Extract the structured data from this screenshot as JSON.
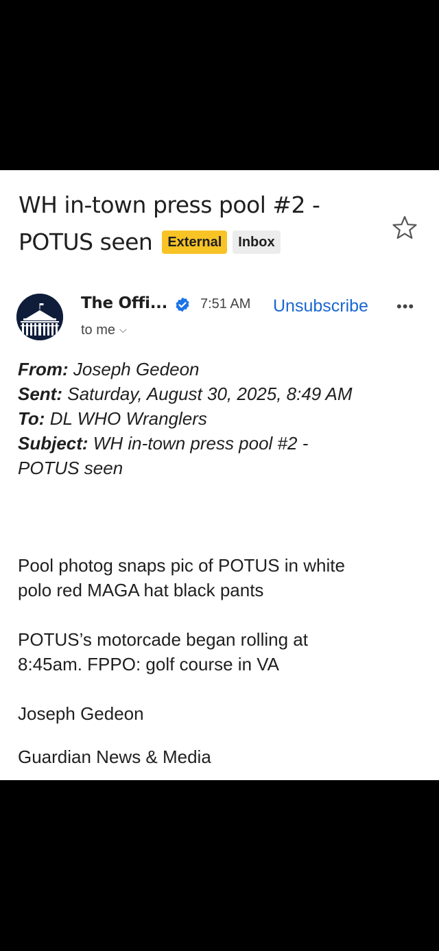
{
  "email": {
    "subject_line1": "WH in-town press pool #2 -",
    "subject_line2": "POTUS seen",
    "labels": {
      "external": "External",
      "inbox": "Inbox"
    },
    "sender_name": "The Offi...",
    "time": "7:51 AM",
    "unsubscribe": "Unsubscribe",
    "more": "•••",
    "recipient": "to me",
    "forwarded": {
      "from_label": "From:",
      "from_value": " Joseph Gedeon",
      "sent_label": "Sent:",
      "sent_value": " Saturday, August 30, 2025, 8:49 AM",
      "to_label": "To:",
      "to_value": " DL WHO Wranglers",
      "subject_label": "Subject:",
      "subject_value": " WH in-town press pool #2 -",
      "subject_value_line2": "POTUS seen"
    },
    "body": {
      "para1_line1": "Pool photog snaps pic of POTUS in white",
      "para1_line2": "polo red MAGA hat black pants",
      "para2_line1": "POTUS’s motorcade began rolling at",
      "para2_line2": "8:45am. FPPO: golf course in VA",
      "signature_name": "Joseph Gedeon",
      "signature_org": "Guardian News & Media"
    }
  },
  "colors": {
    "link": "#1a67d2",
    "external_chip": "#f7c325",
    "verified": "#1a73e8"
  },
  "icons": {
    "star": "star-icon",
    "verified": "verified-badge-icon",
    "avatar": "white-house-icon"
  }
}
